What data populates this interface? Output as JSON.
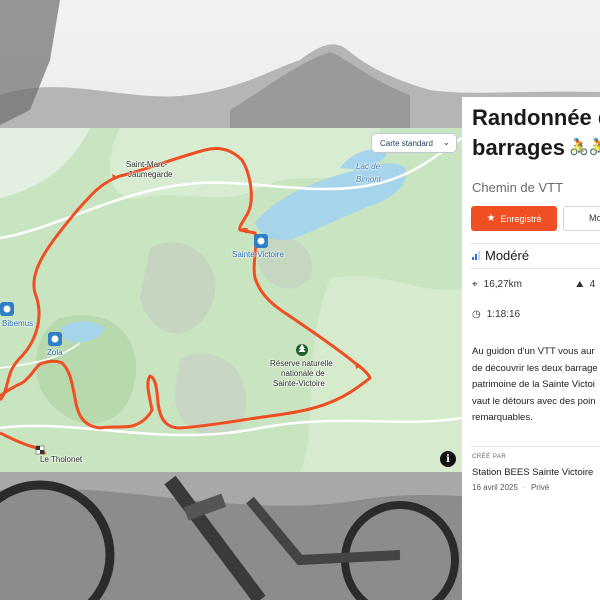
{
  "map": {
    "style_button": "Carte standard",
    "info": "i",
    "labels": {
      "saint_marc": "Saint-Marc-",
      "saint_marc_2": "Jaumegarde",
      "lac_1": "Lac de",
      "lac_2": "Bimont",
      "sainte_victoire": "Sainte-Victoire",
      "bimont_poi": "Bimont",
      "zola": "Zola",
      "reserve_1": "Réserve naturelle",
      "reserve_2": "nationale de",
      "reserve_3": "Sainte-Victoire",
      "tholonet": "Le Tholonet",
      "bibemus": "Bibemus"
    },
    "route_color": "#f04e23"
  },
  "panel": {
    "title_line1": "Randonnée d",
    "title_line2": "barrages",
    "subtitle": "Chemin de VTT",
    "save_button": "Enregistré",
    "more_button": "Mo",
    "difficulty": "Modéré",
    "distance": "16,27km",
    "elevation": "4",
    "duration": "1:18:16",
    "description_lines": [
      "Au guidon d'un VTT vous aur",
      "de découvrir les deux barrage",
      "patrimoine de la Sainte Victoi",
      "vaut le détours avec des poin",
      "remarquables."
    ],
    "created_by_label": "CRÉÉ PAR",
    "author": "Station BEES Sainte Victoire",
    "date": "16 avril 2025",
    "visibility": "Privé",
    "accent_color": "#f04e23"
  }
}
